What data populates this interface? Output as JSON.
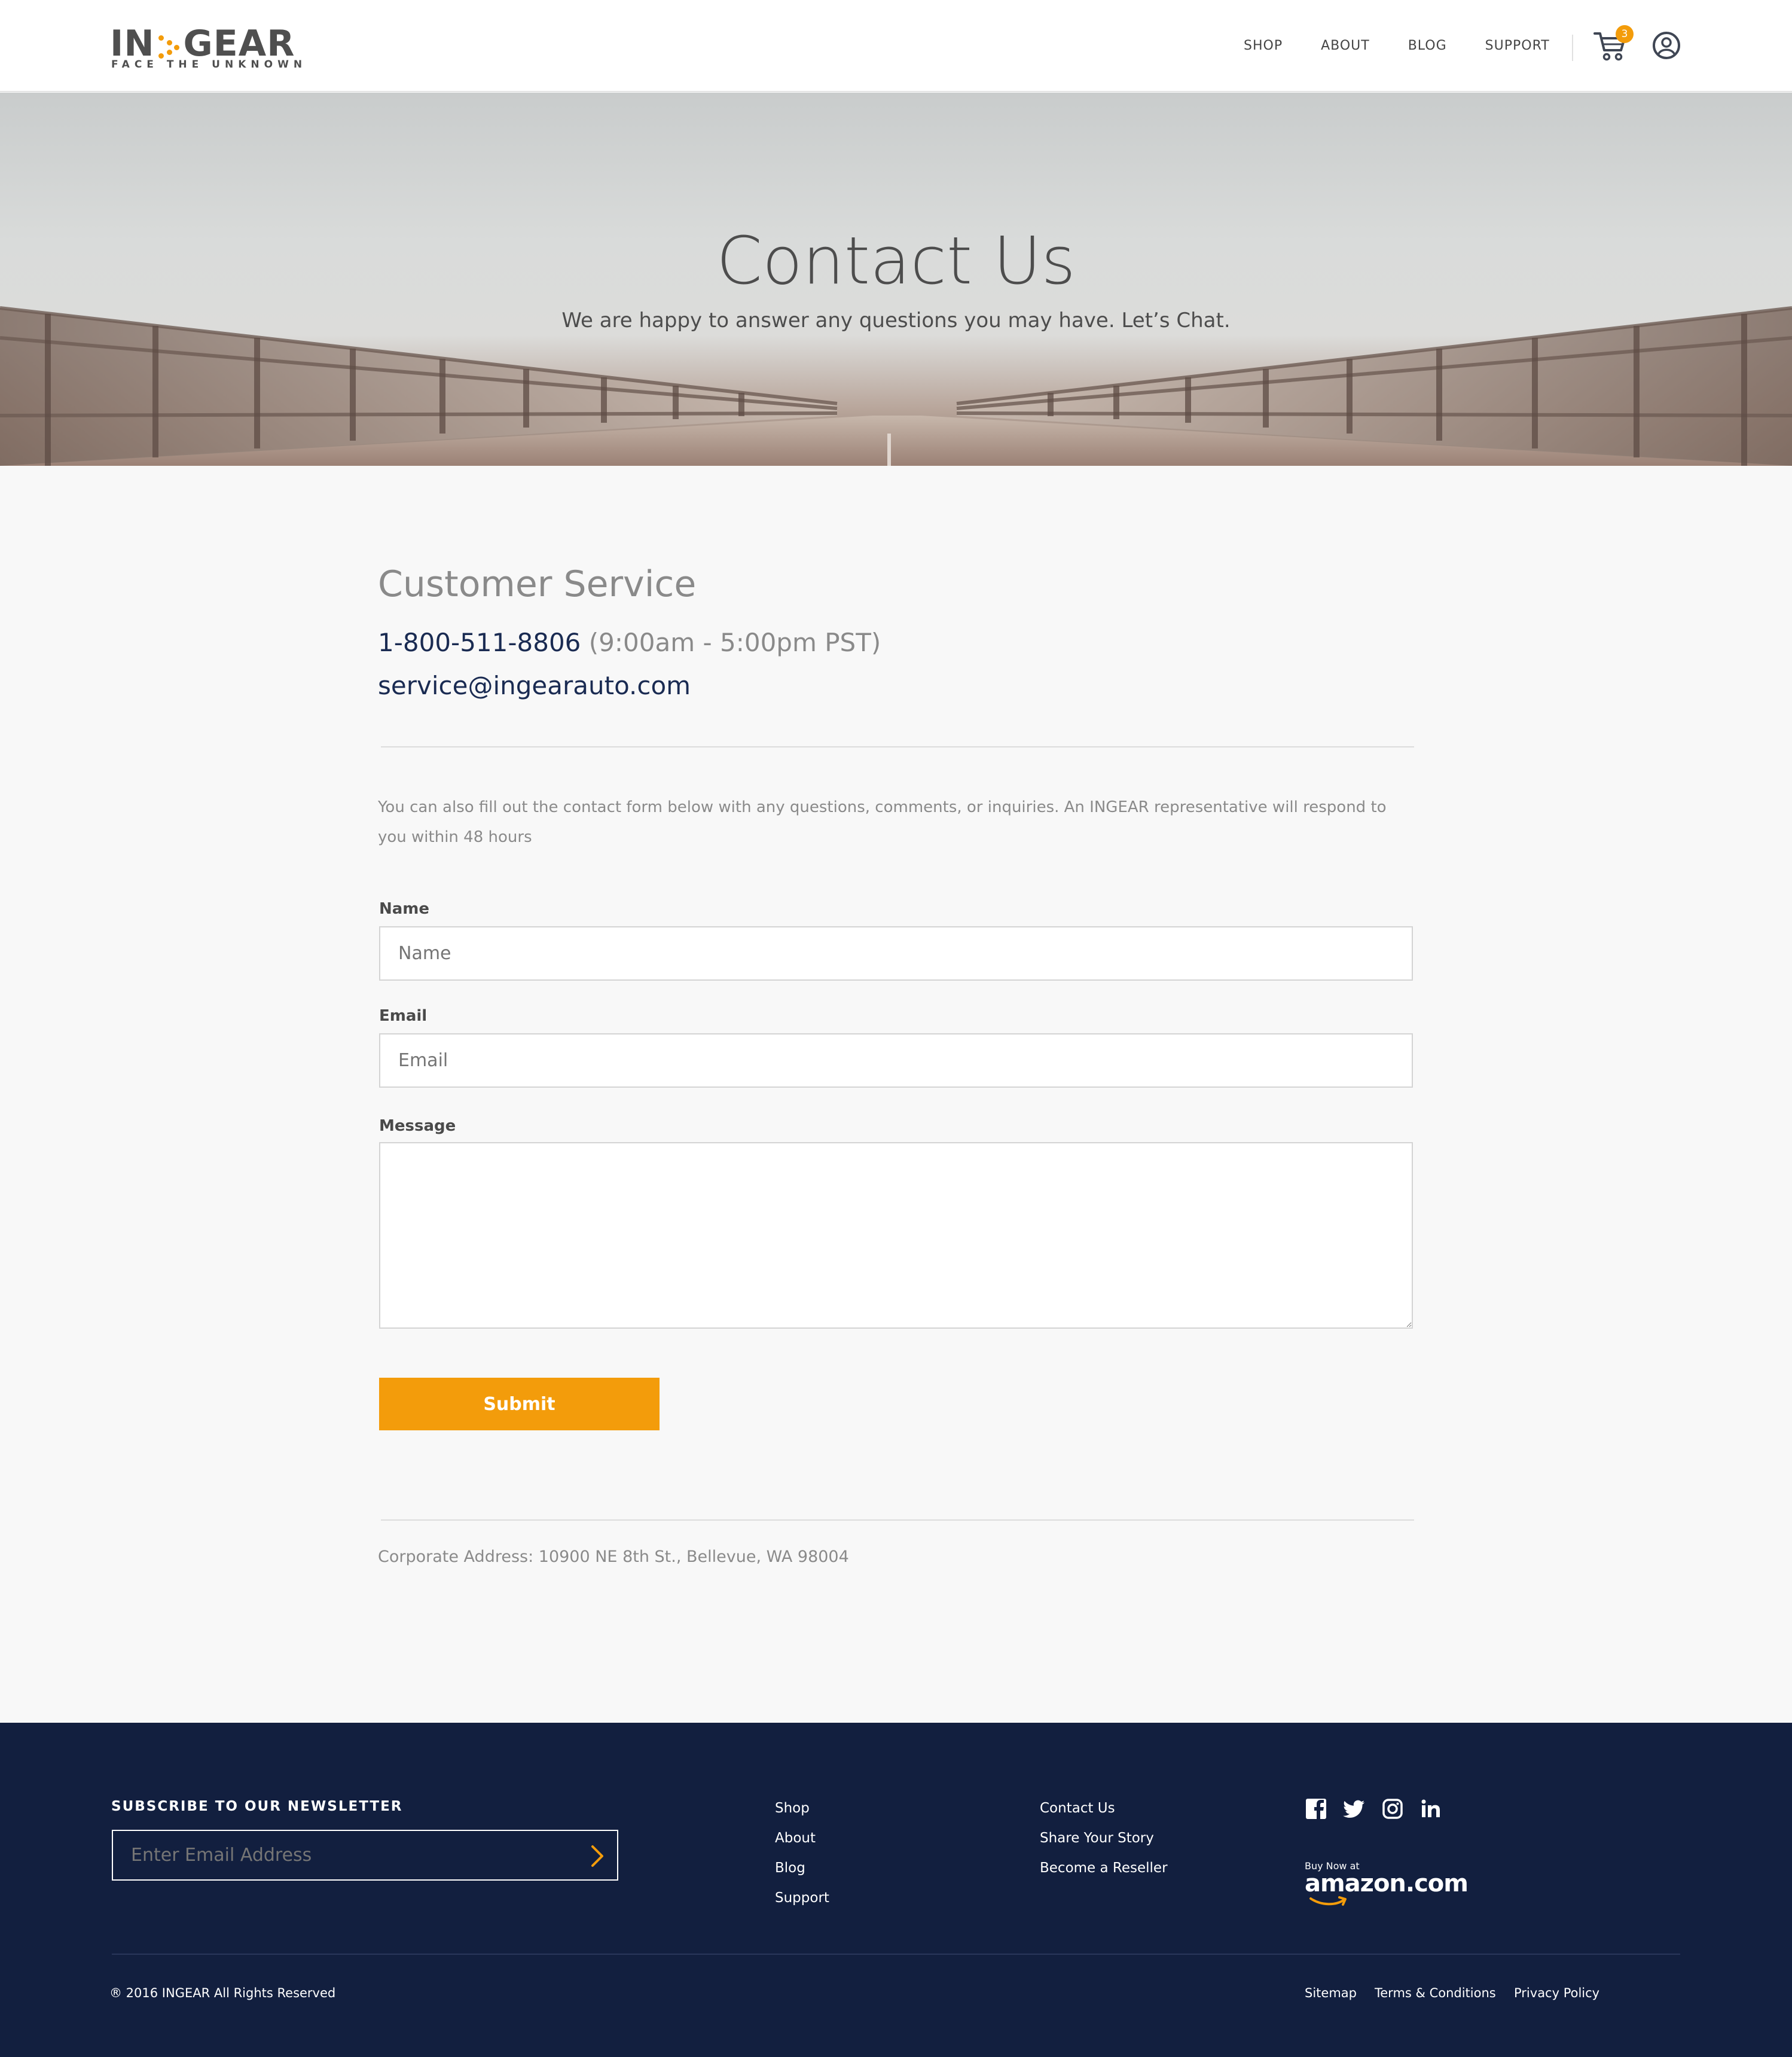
{
  "brand": {
    "name_left": "IN",
    "name_right": "GEAR",
    "tagline": "FACE THE UNKNOWN",
    "accent_color": "#f39c0b",
    "navy": "#121f3f"
  },
  "nav": {
    "items": [
      "SHOP",
      "ABOUT",
      "BLOG",
      "SUPPORT"
    ],
    "cart_count": "3",
    "cart_icon": "cart-icon",
    "account_icon": "user-circle-icon"
  },
  "hero": {
    "title": "Contact Us",
    "subtitle": "We are happy to answer any questions you may have. Let’s Chat."
  },
  "customer_service": {
    "title": "Customer Service",
    "phone": "1-800-511-8806",
    "hours": "(9:00am - 5:00pm PST)",
    "email": "service@ingearauto.com"
  },
  "intro_text": "You can also fill out the contact form below with any questions, comments, or inquiries. An INGEAR representative will respond to you within 48 hours",
  "form": {
    "name_label": "Name",
    "name_placeholder": "Name",
    "name_value": "",
    "email_label": "Email",
    "email_placeholder": "Email",
    "email_value": "",
    "message_label": "Message",
    "message_value": "",
    "submit_label": "Submit"
  },
  "address": "Corporate Address: 10900 NE 8th St., Bellevue, WA 98004",
  "footer": {
    "newsletter_title": "SUBSCRIBE TO OUR NEWSLETTER",
    "newsletter_placeholder": "Enter Email Address",
    "col1": [
      "Shop",
      "About",
      "Blog",
      "Support"
    ],
    "col2": [
      "Contact Us",
      "Share Your Story",
      "Become a Reseller"
    ],
    "social_icons": [
      "facebook-icon",
      "twitter-icon",
      "instagram-icon",
      "linkedin-icon"
    ],
    "amazon_small": "Buy Now at",
    "amazon_word": "amazon.com",
    "copyright": "® 2016 INGEAR All Rights Reserved",
    "legal": [
      "Sitemap",
      "Terms & Conditions",
      "Privacy Policy"
    ]
  }
}
